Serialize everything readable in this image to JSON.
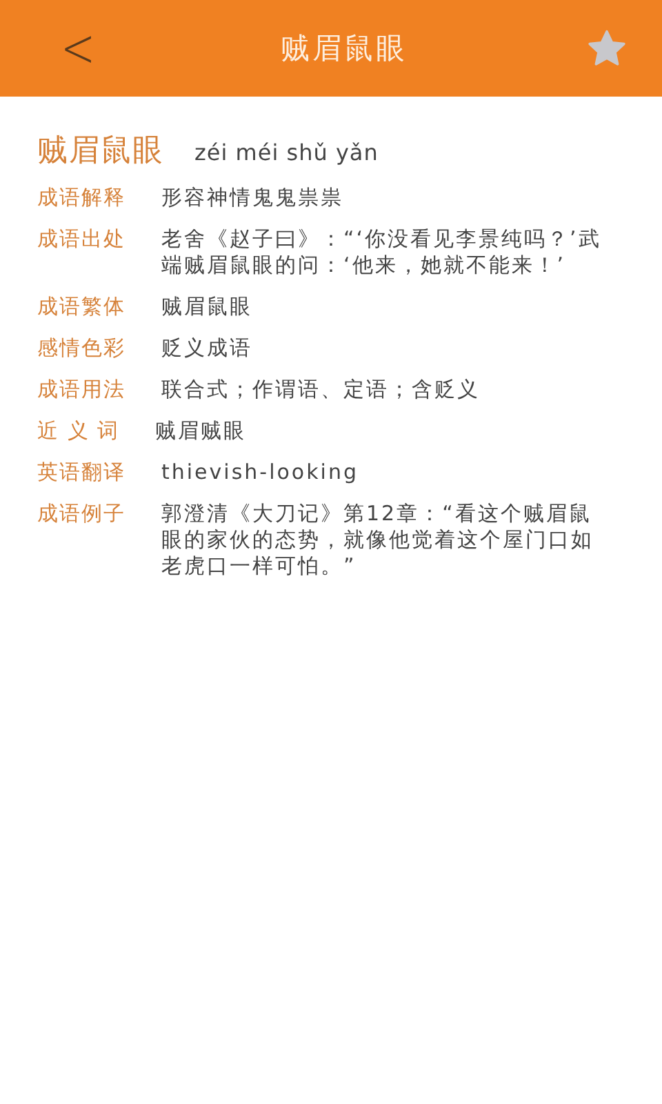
{
  "header": {
    "title": "贼眉鼠眼",
    "back": "<",
    "favorited": false
  },
  "idiom": {
    "word": "贼眉鼠眼",
    "pinyin": "zéi méi shǔ yǎn"
  },
  "details": [
    {
      "label": "成语解释",
      "value": "形容神情鬼鬼祟祟"
    },
    {
      "label": "成语出处",
      "value": "老舍《赵子曰》：“‘你没看见李景纯吗？’武端贼眉鼠眼的问：‘他来，她就不能来！’"
    },
    {
      "label": "成语繁体",
      "value": "贼眉鼠眼"
    },
    {
      "label": "感情色彩",
      "value": "贬义成语"
    },
    {
      "label": "成语用法",
      "value": "联合式；作谓语、定语；含贬义"
    },
    {
      "label": "近 义 词",
      "value": "贼眉贼眼"
    },
    {
      "label": "英语翻译",
      "value": "thievish-looking"
    },
    {
      "label": "成语例子",
      "value": "郭澄清《大刀记》第12章：“看这个贼眉鼠眼的家伙的态势，就像他觉着这个屋门口如老虎口一样可怕。”"
    }
  ]
}
